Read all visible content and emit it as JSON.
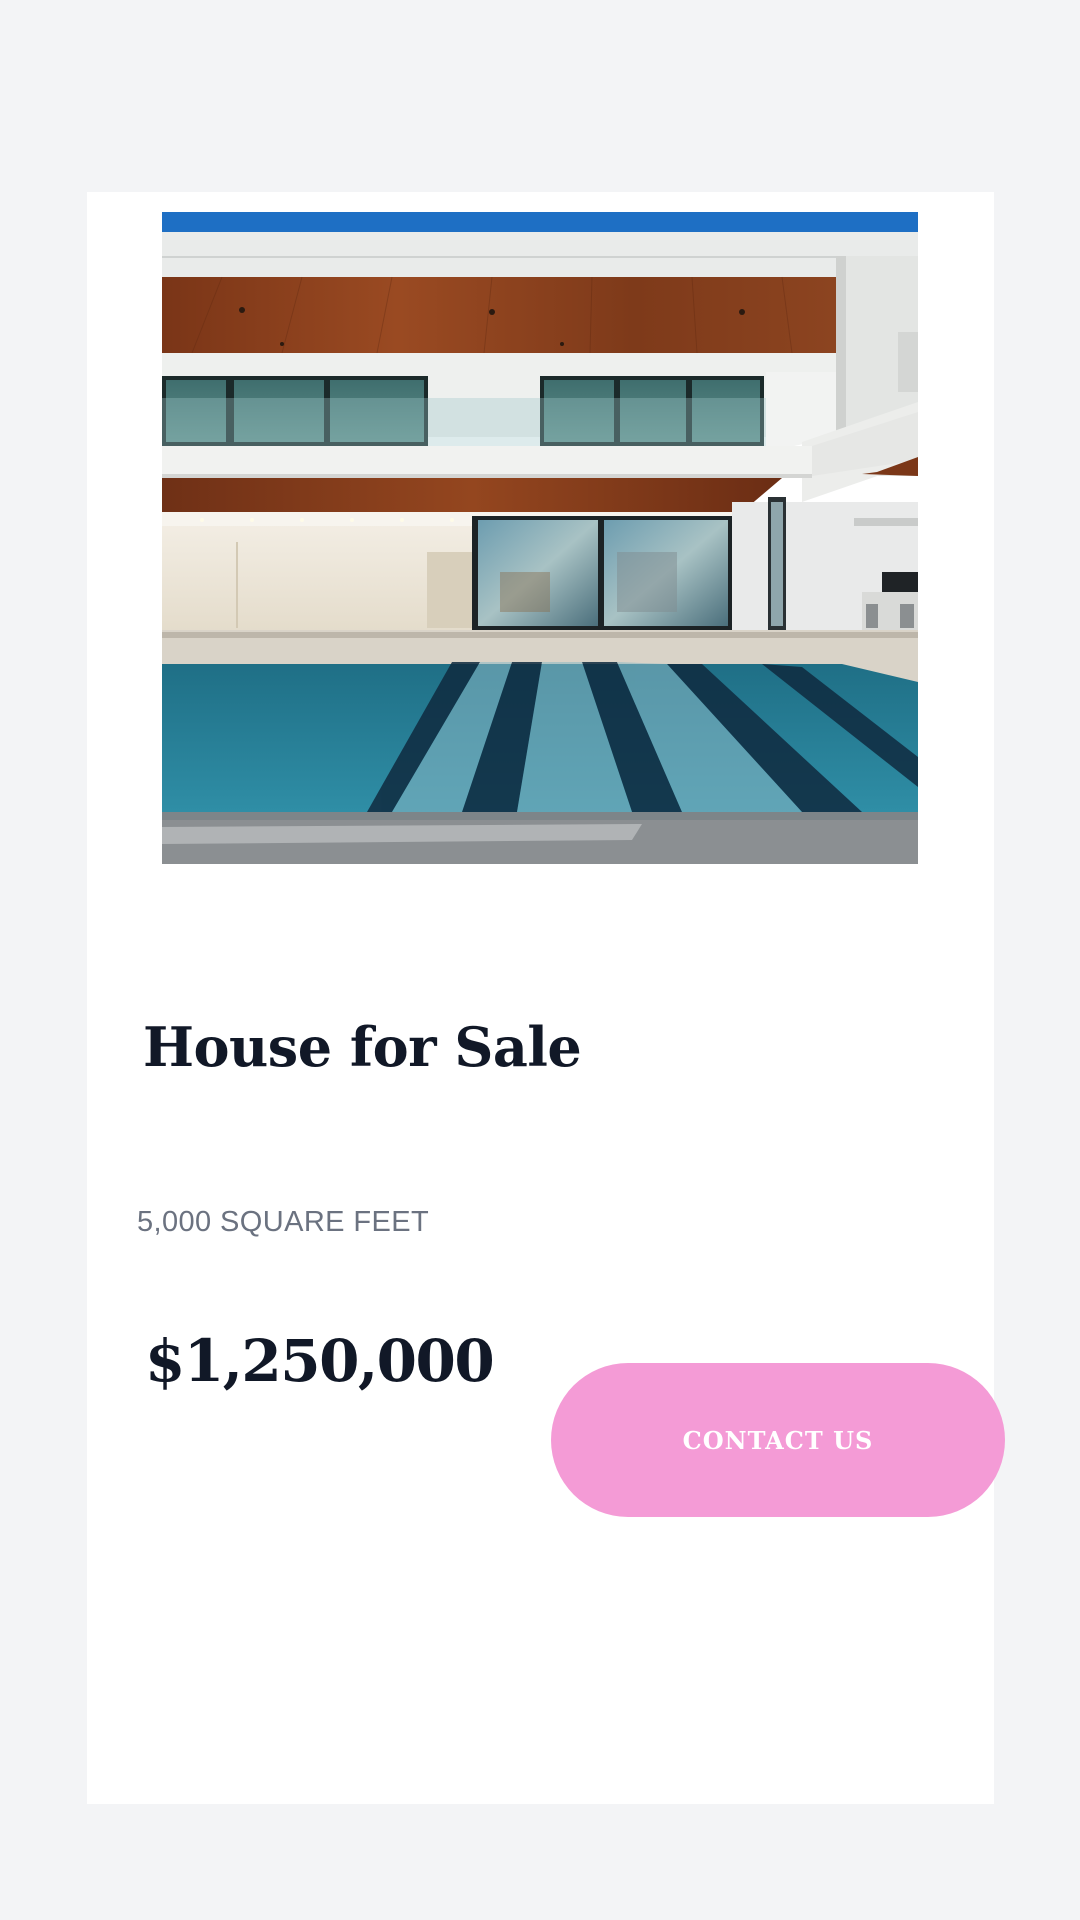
{
  "listing": {
    "image_alt": "Modern two-story house with infinity pool",
    "title": "House for Sale",
    "area": "5,000 SQUARE FEET",
    "price": "$1,250,000",
    "contact_label": "CONTACT US"
  },
  "colors": {
    "page_background": "#f3f4f6",
    "card_background": "#ffffff",
    "text_primary": "#111827",
    "text_secondary": "#6b7280",
    "button_background": "#f49bd6",
    "button_text": "#ffffff"
  }
}
